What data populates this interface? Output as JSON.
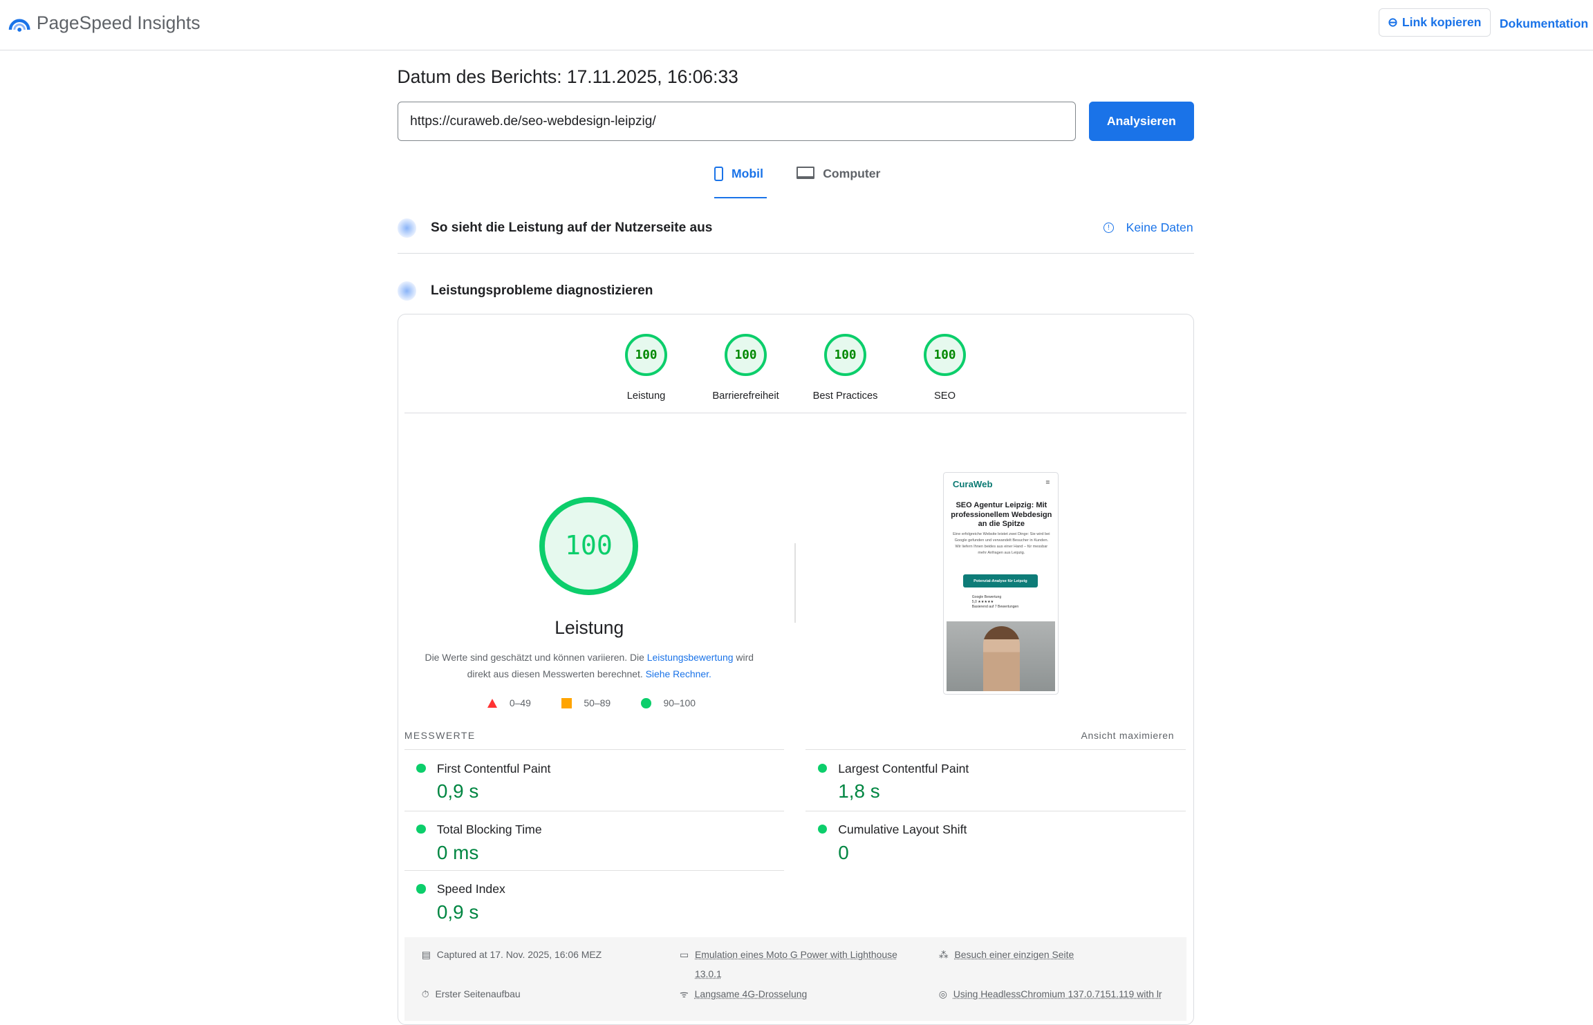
{
  "header": {
    "app_title": "PageSpeed Insights",
    "copy_link": "Link kopieren",
    "docs": "Dokumentation"
  },
  "report": {
    "date": "Datum des Berichts: 17.11.2025, 16:06:33",
    "url": "https://curaweb.de/seo-webdesign-leipzig/",
    "analyze": "Analysieren"
  },
  "tabs": [
    {
      "label": "Mobil",
      "active": true
    },
    {
      "label": "Computer",
      "active": false
    }
  ],
  "field": {
    "title": "So sieht die Leistung auf der Nutzerseite aus",
    "no_data": "Keine Daten"
  },
  "lab": {
    "title": "Leistungsprobleme diagnostizieren"
  },
  "scores": [
    {
      "value": "100",
      "label": "Leistung"
    },
    {
      "value": "100",
      "label": "Barrierefreiheit"
    },
    {
      "value": "100",
      "label": "Best Practices"
    },
    {
      "value": "100",
      "label": "SEO"
    }
  ],
  "perf": {
    "score": "100",
    "title": "Leistung",
    "desc1": "Die Werte sind geschätzt und können variieren. Die ",
    "link1": "Leistungsbewertung",
    "desc2": " wird direkt aus diesen Messwerten berechnet. ",
    "link2": "Siehe Rechner."
  },
  "legend": [
    "0–49",
    "50–89",
    "90–100"
  ],
  "colors": {
    "good": "#0cce6b",
    "average": "#ffa400",
    "poor": "#ff3333",
    "accent": "#1a73e8"
  },
  "preview": {
    "logo": "CuraWeb",
    "headline": "SEO Agentur Leipzig: Mit professionellem Webdesign an die Spitze",
    "text": "Eine erfolgreiche Website leistet zwei Dinge: Sie wird bei Google gefunden und verwandelt Besucher in Kunden. Wir liefern Ihnen beides aus einer Hand – für messbar mehr Anfragen aus Leipzig.",
    "button": "Potenzial-Analyse für Leipzig",
    "rating_label": "Google Bewertung",
    "rating": "5,0 ★★★★★",
    "rating_sub": "Basierend auf 7 Bewertungen"
  },
  "metrics_label": "MESSWERTE",
  "expand_view": "Ansicht maximieren",
  "metrics": [
    {
      "name": "First Contentful Paint",
      "value": "0,9 s"
    },
    {
      "name": "Largest Contentful Paint",
      "value": "1,8 s"
    },
    {
      "name": "Total Blocking Time",
      "value": "0 ms"
    },
    {
      "name": "Cumulative Layout Shift",
      "value": "0"
    },
    {
      "name": "Speed Index",
      "value": "0,9 s"
    }
  ],
  "footer": {
    "captured": "Captured at 17. Nov. 2025, 16:06 MEZ",
    "emulation": "Emulation eines Moto G Power with Lighthouse 13.0.1",
    "visit": "Besuch einer einzigen Seite",
    "first_load": "Erster Seitenaufbau",
    "throttle": "Langsame 4G-Drosselung",
    "browser": "Using HeadlessChromium 137.0.7151.119 with lr"
  }
}
